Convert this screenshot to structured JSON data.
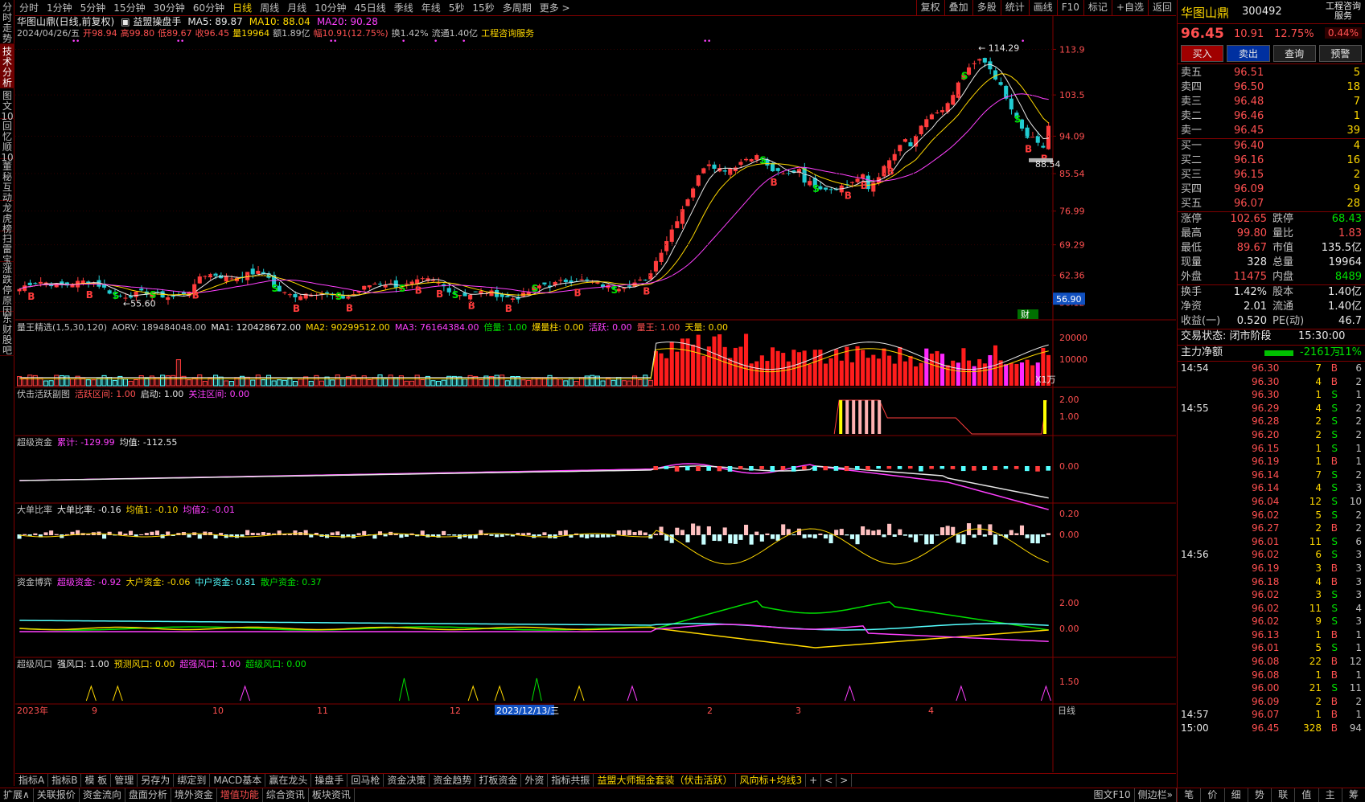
{
  "left_nav": [
    "分时走势",
    "技术分析",
    "图文10",
    "回忆顺10",
    "董秘互动",
    "龙虎榜",
    "扫雷宝",
    "涨跌停原因",
    "东财股吧"
  ],
  "period_tabs": [
    "分时",
    "1分钟",
    "5分钟",
    "15分钟",
    "30分钟",
    "60分钟",
    "日线",
    "周线",
    "月线",
    "10分钟",
    "45日线",
    "季线",
    "年线",
    "5秒",
    "15秒",
    "多周期",
    "更多 >"
  ],
  "active_period": "日线",
  "top_right_buttons": [
    "复权",
    "叠加",
    "多股",
    "统计",
    "画线",
    "F10",
    "标记",
    "+自选",
    "返回"
  ],
  "title_line": "华图山鼎(日线,前复权)",
  "indicator_name": "益盟操盘手",
  "ma_items": [
    {
      "label": "MA5: 89.87",
      "color": "#e8e8e8"
    },
    {
      "label": "MA10: 88.04",
      "color": "#ffd800"
    },
    {
      "label": "MA20: 90.28",
      "color": "#ff40ff"
    }
  ],
  "ohlc_line": [
    {
      "t": "2024/04/26/五",
      "c": "#c0c0c0"
    },
    {
      "t": "开98.94",
      "c": "#ff5050"
    },
    {
      "t": "高99.80",
      "c": "#ff5050"
    },
    {
      "t": "低89.67",
      "c": "#ff5050"
    },
    {
      "t": "收96.45",
      "c": "#ff5050"
    },
    {
      "t": "量19964",
      "c": "#ffd800"
    },
    {
      "t": "额1.89亿",
      "c": "#c0c0c0"
    },
    {
      "t": "幅10.91(12.75%)",
      "c": "#ff5050"
    },
    {
      "t": "换1.42%",
      "c": "#c0c0c0"
    },
    {
      "t": "流通1.40亿",
      "c": "#c0c0c0"
    },
    {
      "t": "工程咨询服务",
      "c": "#ffd800"
    }
  ],
  "price_axis": [
    "113.9",
    "103.5",
    "94.09",
    "85.54",
    "76.99",
    "69.29",
    "62.36",
    "56.12"
  ],
  "price_marks": {
    "high_label": "114.29",
    "low_label": "55.60",
    "cur_label": "88.54",
    "box_label": "56.90",
    "finance_label": "财"
  },
  "panel2": {
    "items": [
      {
        "t": "量王精选(1,5,30,120)",
        "c": "#c0c0c0"
      },
      {
        "t": "AORV: 189484048.00",
        "c": "#c0c0c0"
      },
      {
        "t": "MA1: 120428672.00",
        "c": "#e8e8e8"
      },
      {
        "t": "MA2: 90299512.00",
        "c": "#ffd800"
      },
      {
        "t": "MA3: 76164384.00",
        "c": "#ff40ff"
      },
      {
        "t": "倍量: 1.00",
        "c": "#00e000"
      },
      {
        "t": "爆量柱: 0.00",
        "c": "#ffd800"
      },
      {
        "t": "活跃: 0.00",
        "c": "#ff40ff"
      },
      {
        "t": "量王: 1.00",
        "c": "#ff5050"
      },
      {
        "t": "天量: 0.00",
        "c": "#ffd800"
      }
    ],
    "axis": [
      "20000",
      "10000"
    ],
    "unit": "X1万"
  },
  "panel3": {
    "items": [
      {
        "t": "伏击活跃副图",
        "c": "#c0c0c0"
      },
      {
        "t": "活跃区间: 1.00",
        "c": "#ff5050"
      },
      {
        "t": "启动: 1.00",
        "c": "#e8e8e8"
      },
      {
        "t": "关注区间: 0.00",
        "c": "#ff40ff"
      }
    ],
    "axis": [
      "2.00",
      "1.00"
    ]
  },
  "panel4": {
    "items": [
      {
        "t": "超级资金",
        "c": "#c0c0c0"
      },
      {
        "t": "累计: -129.99",
        "c": "#ff40ff"
      },
      {
        "t": "均值: -112.55",
        "c": "#e8e8e8"
      }
    ],
    "axis": [
      "0.00"
    ]
  },
  "panel5": {
    "items": [
      {
        "t": "大单比率",
        "c": "#c0c0c0"
      },
      {
        "t": "大单比率: -0.16",
        "c": "#e8e8e8"
      },
      {
        "t": "均值1: -0.10",
        "c": "#ffd800"
      },
      {
        "t": "均值2: -0.01",
        "c": "#ff40ff"
      }
    ],
    "axis": [
      "0.20",
      "0.00"
    ]
  },
  "panel6": {
    "items": [
      {
        "t": "资金博弈",
        "c": "#c0c0c0"
      },
      {
        "t": "超级资金: -0.92",
        "c": "#ff40ff"
      },
      {
        "t": "大户资金: -0.06",
        "c": "#ffd800"
      },
      {
        "t": "中户资金: 0.81",
        "c": "#54ffff"
      },
      {
        "t": "散户资金: 0.37",
        "c": "#00e000"
      }
    ],
    "axis": [
      "2.00",
      "0.00"
    ]
  },
  "panel7": {
    "items": [
      {
        "t": "超级风口",
        "c": "#c0c0c0"
      },
      {
        "t": "强风口: 1.00",
        "c": "#e8e8e8"
      },
      {
        "t": "预测风口: 0.00",
        "c": "#ffd800"
      },
      {
        "t": "超强风口: 1.00",
        "c": "#ff40ff"
      },
      {
        "t": "超级风口: 0.00",
        "c": "#00e000"
      }
    ],
    "axis": [
      "1.50"
    ]
  },
  "date_axis": [
    "2023年",
    "9",
    "10",
    "11",
    "12",
    "2023/12/13/三",
    "2",
    "3",
    "4"
  ],
  "date_axis_right": "日线",
  "bottom_tabs1": [
    "指标A",
    "指标B",
    "模 板",
    "管理",
    "另存为",
    "绑定到",
    "MACD基本",
    "赢在龙头",
    "操盘手",
    "回马枪",
    "资金决策",
    "资金趋势",
    "打板资金",
    "外资",
    "指标共振",
    "益盟大师掘金套装（伏击活跃）",
    "风向标+均线3",
    "+",
    "<",
    ">"
  ],
  "bottom_tabs2": [
    "扩展∧",
    "关联报价",
    "资金流向",
    "盘面分析",
    "境外资金",
    "增值功能",
    "综合资讯",
    "板块资讯"
  ],
  "bottom_right2": [
    "图文F10",
    "侧边栏»"
  ],
  "quote": {
    "name": "华图山鼎",
    "code": "300492",
    "badge": "工程咨询服务",
    "badge_pct": "0.44%",
    "price": "96.45",
    "change": "10.91",
    "pct": "12.75%",
    "buttons": [
      "买入",
      "卖出",
      "查询",
      "预警"
    ],
    "sells": [
      [
        "卖五",
        "96.51",
        "5"
      ],
      [
        "卖四",
        "96.50",
        "18"
      ],
      [
        "卖三",
        "96.48",
        "7"
      ],
      [
        "卖二",
        "96.46",
        "1"
      ],
      [
        "卖一",
        "96.45",
        "39"
      ]
    ],
    "buys": [
      [
        "买一",
        "96.40",
        "4"
      ],
      [
        "买二",
        "96.16",
        "16"
      ],
      [
        "买三",
        "96.15",
        "2"
      ],
      [
        "买四",
        "96.09",
        "9"
      ],
      [
        "买五",
        "96.07",
        "28"
      ]
    ],
    "stats": [
      [
        "涨停",
        "102.65",
        "#ff5050",
        "跌停",
        "68.43",
        "#00e000"
      ],
      [
        "最高",
        "99.80",
        "#ff5050",
        "量比",
        "1.83",
        "#ff5050"
      ],
      [
        "最低",
        "89.67",
        "#ff5050",
        "市值",
        "135.5亿",
        "#e8e8e8"
      ],
      [
        "现量",
        "328",
        "#e8e8e8",
        "总量",
        "19964",
        "#e8e8e8"
      ],
      [
        "外盘",
        "11475",
        "#ff5050",
        "内盘",
        "8489",
        "#00e000"
      ]
    ],
    "stats2": [
      [
        "换手",
        "1.42%",
        "#e8e8e8",
        "股本",
        "1.40亿",
        "#e8e8e8"
      ],
      [
        "净资",
        "2.01",
        "#e8e8e8",
        "流通",
        "1.40亿",
        "#e8e8e8"
      ],
      [
        "收益(一)",
        "0.520",
        "#e8e8e8",
        "PE(动)",
        "46.7",
        "#e8e8e8"
      ]
    ],
    "status_label": "交易状态: 闭市阶段",
    "status_time": "15:30:00",
    "net_label": "主力净额",
    "net_value": "-2161万",
    "net_pct": "-11%"
  },
  "ticks": [
    [
      "14:54",
      "96.30",
      "7",
      "B",
      "6"
    ],
    [
      "",
      "96.30",
      "4",
      "B",
      "2"
    ],
    [
      "",
      "96.30",
      "1",
      "S",
      "1"
    ],
    [
      "14:55",
      "96.29",
      "4",
      "S",
      "2"
    ],
    [
      "",
      "96.28",
      "2",
      "S",
      "2"
    ],
    [
      "",
      "96.20",
      "2",
      "S",
      "2"
    ],
    [
      "",
      "96.15",
      "1",
      "S",
      "1"
    ],
    [
      "",
      "96.19",
      "1",
      "B",
      "1"
    ],
    [
      "",
      "96.14",
      "7",
      "S",
      "2"
    ],
    [
      "",
      "96.14",
      "4",
      "S",
      "3"
    ],
    [
      "",
      "96.04",
      "12",
      "S",
      "10"
    ],
    [
      "",
      "96.02",
      "5",
      "S",
      "2"
    ],
    [
      "",
      "96.27",
      "2",
      "B",
      "2"
    ],
    [
      "",
      "96.01",
      "11",
      "S",
      "6"
    ],
    [
      "14:56",
      "96.02",
      "6",
      "S",
      "3"
    ],
    [
      "",
      "96.19",
      "3",
      "B",
      "3"
    ],
    [
      "",
      "96.18",
      "4",
      "B",
      "3"
    ],
    [
      "",
      "96.02",
      "3",
      "S",
      "3"
    ],
    [
      "",
      "96.02",
      "11",
      "S",
      "4"
    ],
    [
      "",
      "96.02",
      "9",
      "S",
      "3"
    ],
    [
      "",
      "96.13",
      "1",
      "B",
      "1"
    ],
    [
      "",
      "96.01",
      "5",
      "S",
      "1"
    ],
    [
      "",
      "96.08",
      "22",
      "B",
      "12"
    ],
    [
      "",
      "96.08",
      "1",
      "B",
      "1"
    ],
    [
      "",
      "96.00",
      "21",
      "S",
      "11"
    ],
    [
      "",
      "96.09",
      "2",
      "B",
      "2"
    ],
    [
      "14:57",
      "96.07",
      "1",
      "B",
      "1"
    ],
    [
      "15:00",
      "96.45",
      "328",
      "B",
      "94"
    ]
  ],
  "right_bottom": [
    "笔",
    "价",
    "细",
    "势",
    "联",
    "值",
    "主",
    "筹"
  ]
}
